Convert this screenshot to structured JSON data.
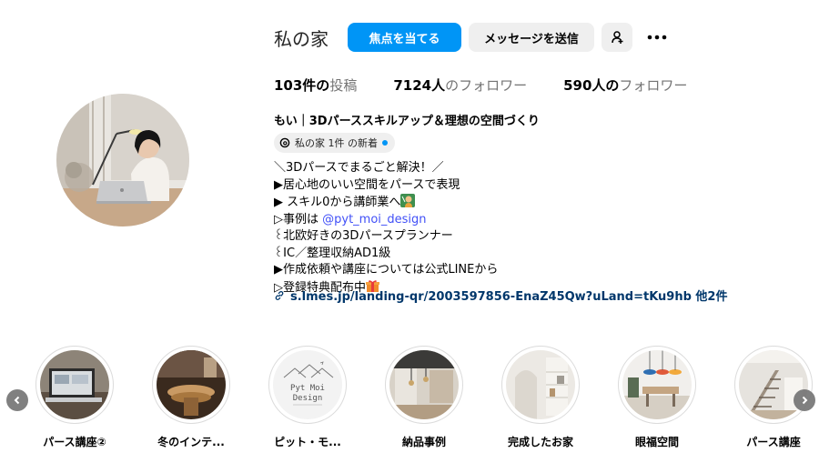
{
  "profile": {
    "username": "私の家",
    "follow_button": "焦点を当てる",
    "message_button": "メッセージを送信",
    "add_user_icon": "add-person-icon",
    "more_icon": "more-dots-icon",
    "stats": [
      {
        "value": "103件の",
        "label": "投稿"
      },
      {
        "value": "7124人",
        "label": "のフォロワー"
      },
      {
        "value": "590人の",
        "label": "フォロワー"
      }
    ],
    "full_name": "もい｜3Dパーススキルアップ＆理想の空間づくり",
    "threads_chip": "私の家 1件 の新着",
    "bio": {
      "line1": "＼3Dパースでまるごと解決！／",
      "line2": "▶居心地のいい空間をパースで表現",
      "line3": "▶ スキル0から講師業へ",
      "line4_prefix": "▷事例は ",
      "line4_mention": "@pyt_moi_design",
      "line5": "꒰北欧好きの3Dパースプランナー",
      "line6": "꒰IC／整理収納AD1級",
      "line7": "▶作成依頼や講座については公式LINEから",
      "line8": "▷登録特典配布中"
    },
    "link": "s.lmes.jp/landing-qr/2003597856-EnaZ45Qw?uLand=tKu9hb 他2件"
  },
  "highlights": [
    {
      "label": "パース講座②"
    },
    {
      "label": "冬のインテ..."
    },
    {
      "label": "ピット・モ..."
    },
    {
      "label": "納品事例"
    },
    {
      "label": "完成したお家"
    },
    {
      "label": "眼福空間"
    },
    {
      "label": "パース講座"
    }
  ],
  "highlight_logo": {
    "line1": "Pyt Moi",
    "line2": "Design"
  },
  "colors": {
    "primary": "#0095f6",
    "link": "#00376b",
    "mention": "#4150f7",
    "muted": "#737373"
  }
}
